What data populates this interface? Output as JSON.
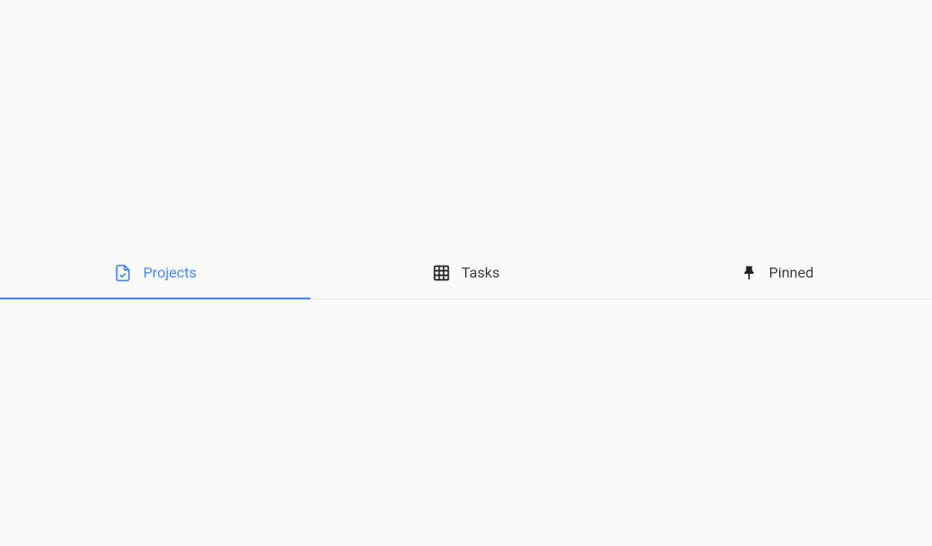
{
  "tabs": [
    {
      "label": "Projects",
      "active": true
    },
    {
      "label": "Tasks",
      "active": false
    },
    {
      "label": "Pinned",
      "active": false
    }
  ]
}
